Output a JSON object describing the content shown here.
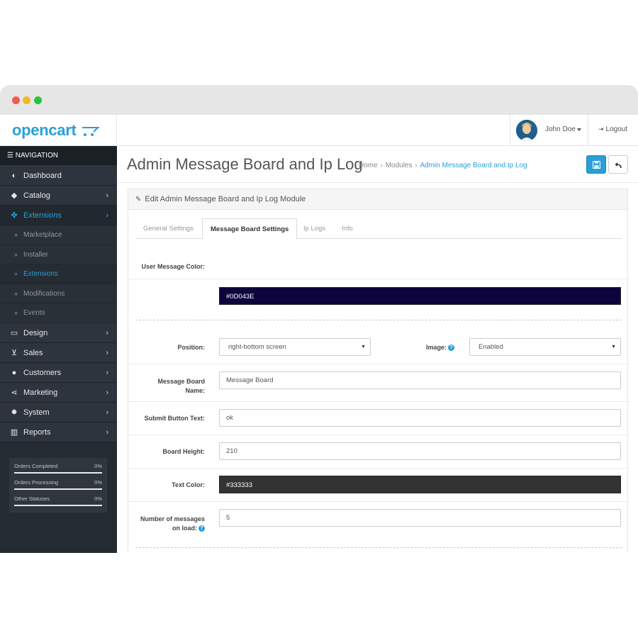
{
  "app": {
    "logo_text": "opencart",
    "user_name": "John Doe",
    "logout_label": "Logout"
  },
  "sidebar": {
    "title": "NAVIGATION",
    "items": [
      {
        "label": "Dashboard",
        "icon": "dashboard-icon"
      },
      {
        "label": "Catalog",
        "icon": "tag-icon"
      },
      {
        "label": "Extensions",
        "icon": "puzzle-icon"
      },
      {
        "label": "Design",
        "icon": "monitor-icon"
      },
      {
        "label": "Sales",
        "icon": "cart-icon"
      },
      {
        "label": "Customers",
        "icon": "user-icon"
      },
      {
        "label": "Marketing",
        "icon": "share-icon"
      },
      {
        "label": "System",
        "icon": "cog-icon"
      },
      {
        "label": "Reports",
        "icon": "bar-chart-icon"
      }
    ],
    "sub_items": [
      {
        "label": "Marketplace"
      },
      {
        "label": "Installer"
      },
      {
        "label": "Extensions"
      },
      {
        "label": "Modifications"
      },
      {
        "label": "Events"
      }
    ],
    "stats": [
      {
        "label": "Orders Completed",
        "value": "0%"
      },
      {
        "label": "Orders Processing",
        "value": "0%"
      },
      {
        "label": "Other Statuses",
        "value": "0%"
      }
    ]
  },
  "main": {
    "title": "Admin Message Board and Ip Log",
    "breadcrumb": [
      "Home",
      "Modules",
      "Admin Message Board and Ip Log"
    ],
    "panel_heading": "Edit Admin Message Board and Ip Log Module",
    "tabs": [
      "General Settings",
      "Message Board Settings",
      "Ip Logs",
      "Info"
    ],
    "active_tab": "Message Board Settings"
  },
  "form": {
    "user_message_color_label": "User Message Color:",
    "user_message_color_value": "#0D043E",
    "position_label": "Position:",
    "position_value": "right-bottom screen",
    "image_label": "Image:",
    "image_value": "Enabled",
    "board_name_label_1": "Message Board",
    "board_name_label_2": "Name:",
    "board_name_value": "Message Board",
    "submit_text_label": "Submit Button Text:",
    "submit_text_value": "ok",
    "board_height_label": "Board Height:",
    "board_height_value": "210",
    "text_color_label": "Text Color:",
    "text_color_value": "#333333",
    "messages_label_1": "Number of messages",
    "messages_label_2": "on load:",
    "messages_value": "5"
  },
  "colors": {
    "accent": "#2a9fd6",
    "sidebar_bg": "#252b33",
    "user_message_color": "#0D043E",
    "text_color": "#333333"
  }
}
